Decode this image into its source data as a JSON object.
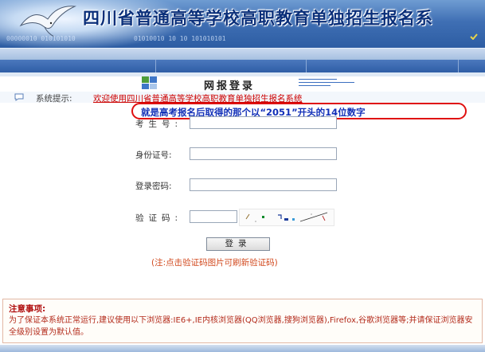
{
  "header": {
    "title": "四川省普通高等学校高职教育单独招生报名系",
    "binary_left": "00000010 010101010",
    "binary_right": "01010010  10  10  101010101"
  },
  "login": {
    "title": "网报登录"
  },
  "system_notice": {
    "label": "系统提示:",
    "text": "欢迎使用四川省普通高等学校高职教育单独招生报名系统"
  },
  "callout": {
    "text": "就是高考报名后取得的那个以“2051”开头的14位数字"
  },
  "form": {
    "exam_number_label": "考生号:",
    "exam_number_value": "",
    "id_number_label": "身份证号:",
    "id_number_value": "",
    "password_label": "登录密码:",
    "password_value": "",
    "captcha_label": "验证码:",
    "captcha_value": "",
    "login_button": "登录",
    "hint": "(注:点击验证码图片可刷新验证码)"
  },
  "notes": {
    "title": "注意事项:",
    "body": "为了保证本系统正常运行,建议使用以下浏览器:IE6+,IE内核浏览器(QQ浏览器,搜狗浏览器),Firefox,谷歌浏览器等;并请保证浏览器安全级别设置为默认值。"
  },
  "colors": {
    "banner_blue": "#2d5da3",
    "callout_border": "#e01010",
    "callout_text": "#1230b8",
    "notice_red": "#cc0000",
    "notes_title": "#b01010"
  },
  "icons": {
    "banner": "seagull-graphic",
    "login": "login-grid-icon",
    "notice": "chat-bubble-icon",
    "corner": "check-icon"
  }
}
